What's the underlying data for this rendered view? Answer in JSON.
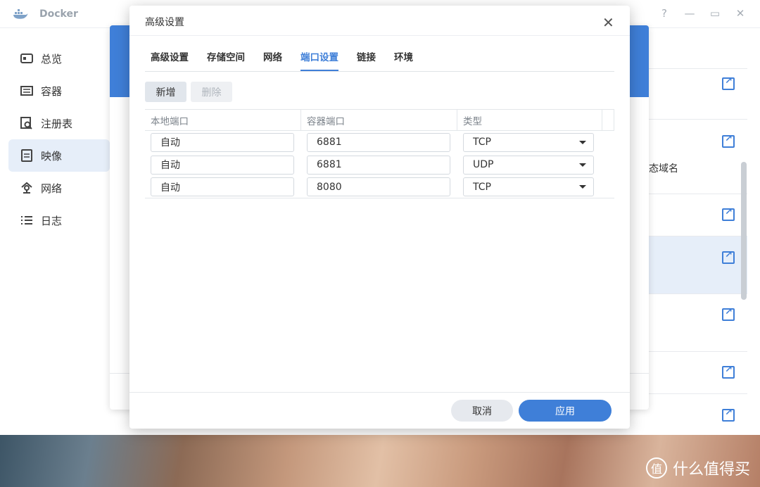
{
  "app": {
    "title": "Docker"
  },
  "window_controls": {
    "help": "?",
    "minimize": "—",
    "maximize": "▭",
    "close": "✕"
  },
  "sidebar": {
    "items": [
      {
        "label": "总览"
      },
      {
        "label": "容器"
      },
      {
        "label": "注册表"
      },
      {
        "label": "映像"
      },
      {
        "label": "网络"
      },
      {
        "label": "日志"
      }
    ]
  },
  "background": {
    "partial_text": "态域名"
  },
  "modal": {
    "title": "高级设置",
    "close": "✕",
    "tabs": [
      {
        "label": "高级设置"
      },
      {
        "label": "存储空间"
      },
      {
        "label": "网络"
      },
      {
        "label": "端口设置"
      },
      {
        "label": "链接"
      },
      {
        "label": "环境"
      }
    ],
    "add_label": "新增",
    "delete_label": "删除",
    "columns": [
      "本地端口",
      "容器端口",
      "类型"
    ],
    "rows": [
      {
        "local": "自动",
        "container": "6881",
        "type": "TCP"
      },
      {
        "local": "自动",
        "container": "6881",
        "type": "UDP"
      },
      {
        "local": "自动",
        "container": "8080",
        "type": "TCP"
      }
    ],
    "cancel_label": "取消",
    "apply_label": "应用"
  },
  "watermark": {
    "logo": "值",
    "text": "什么值得买"
  },
  "colors": {
    "accent": "#3f7fd8",
    "selected_bg": "#e6eef9"
  }
}
